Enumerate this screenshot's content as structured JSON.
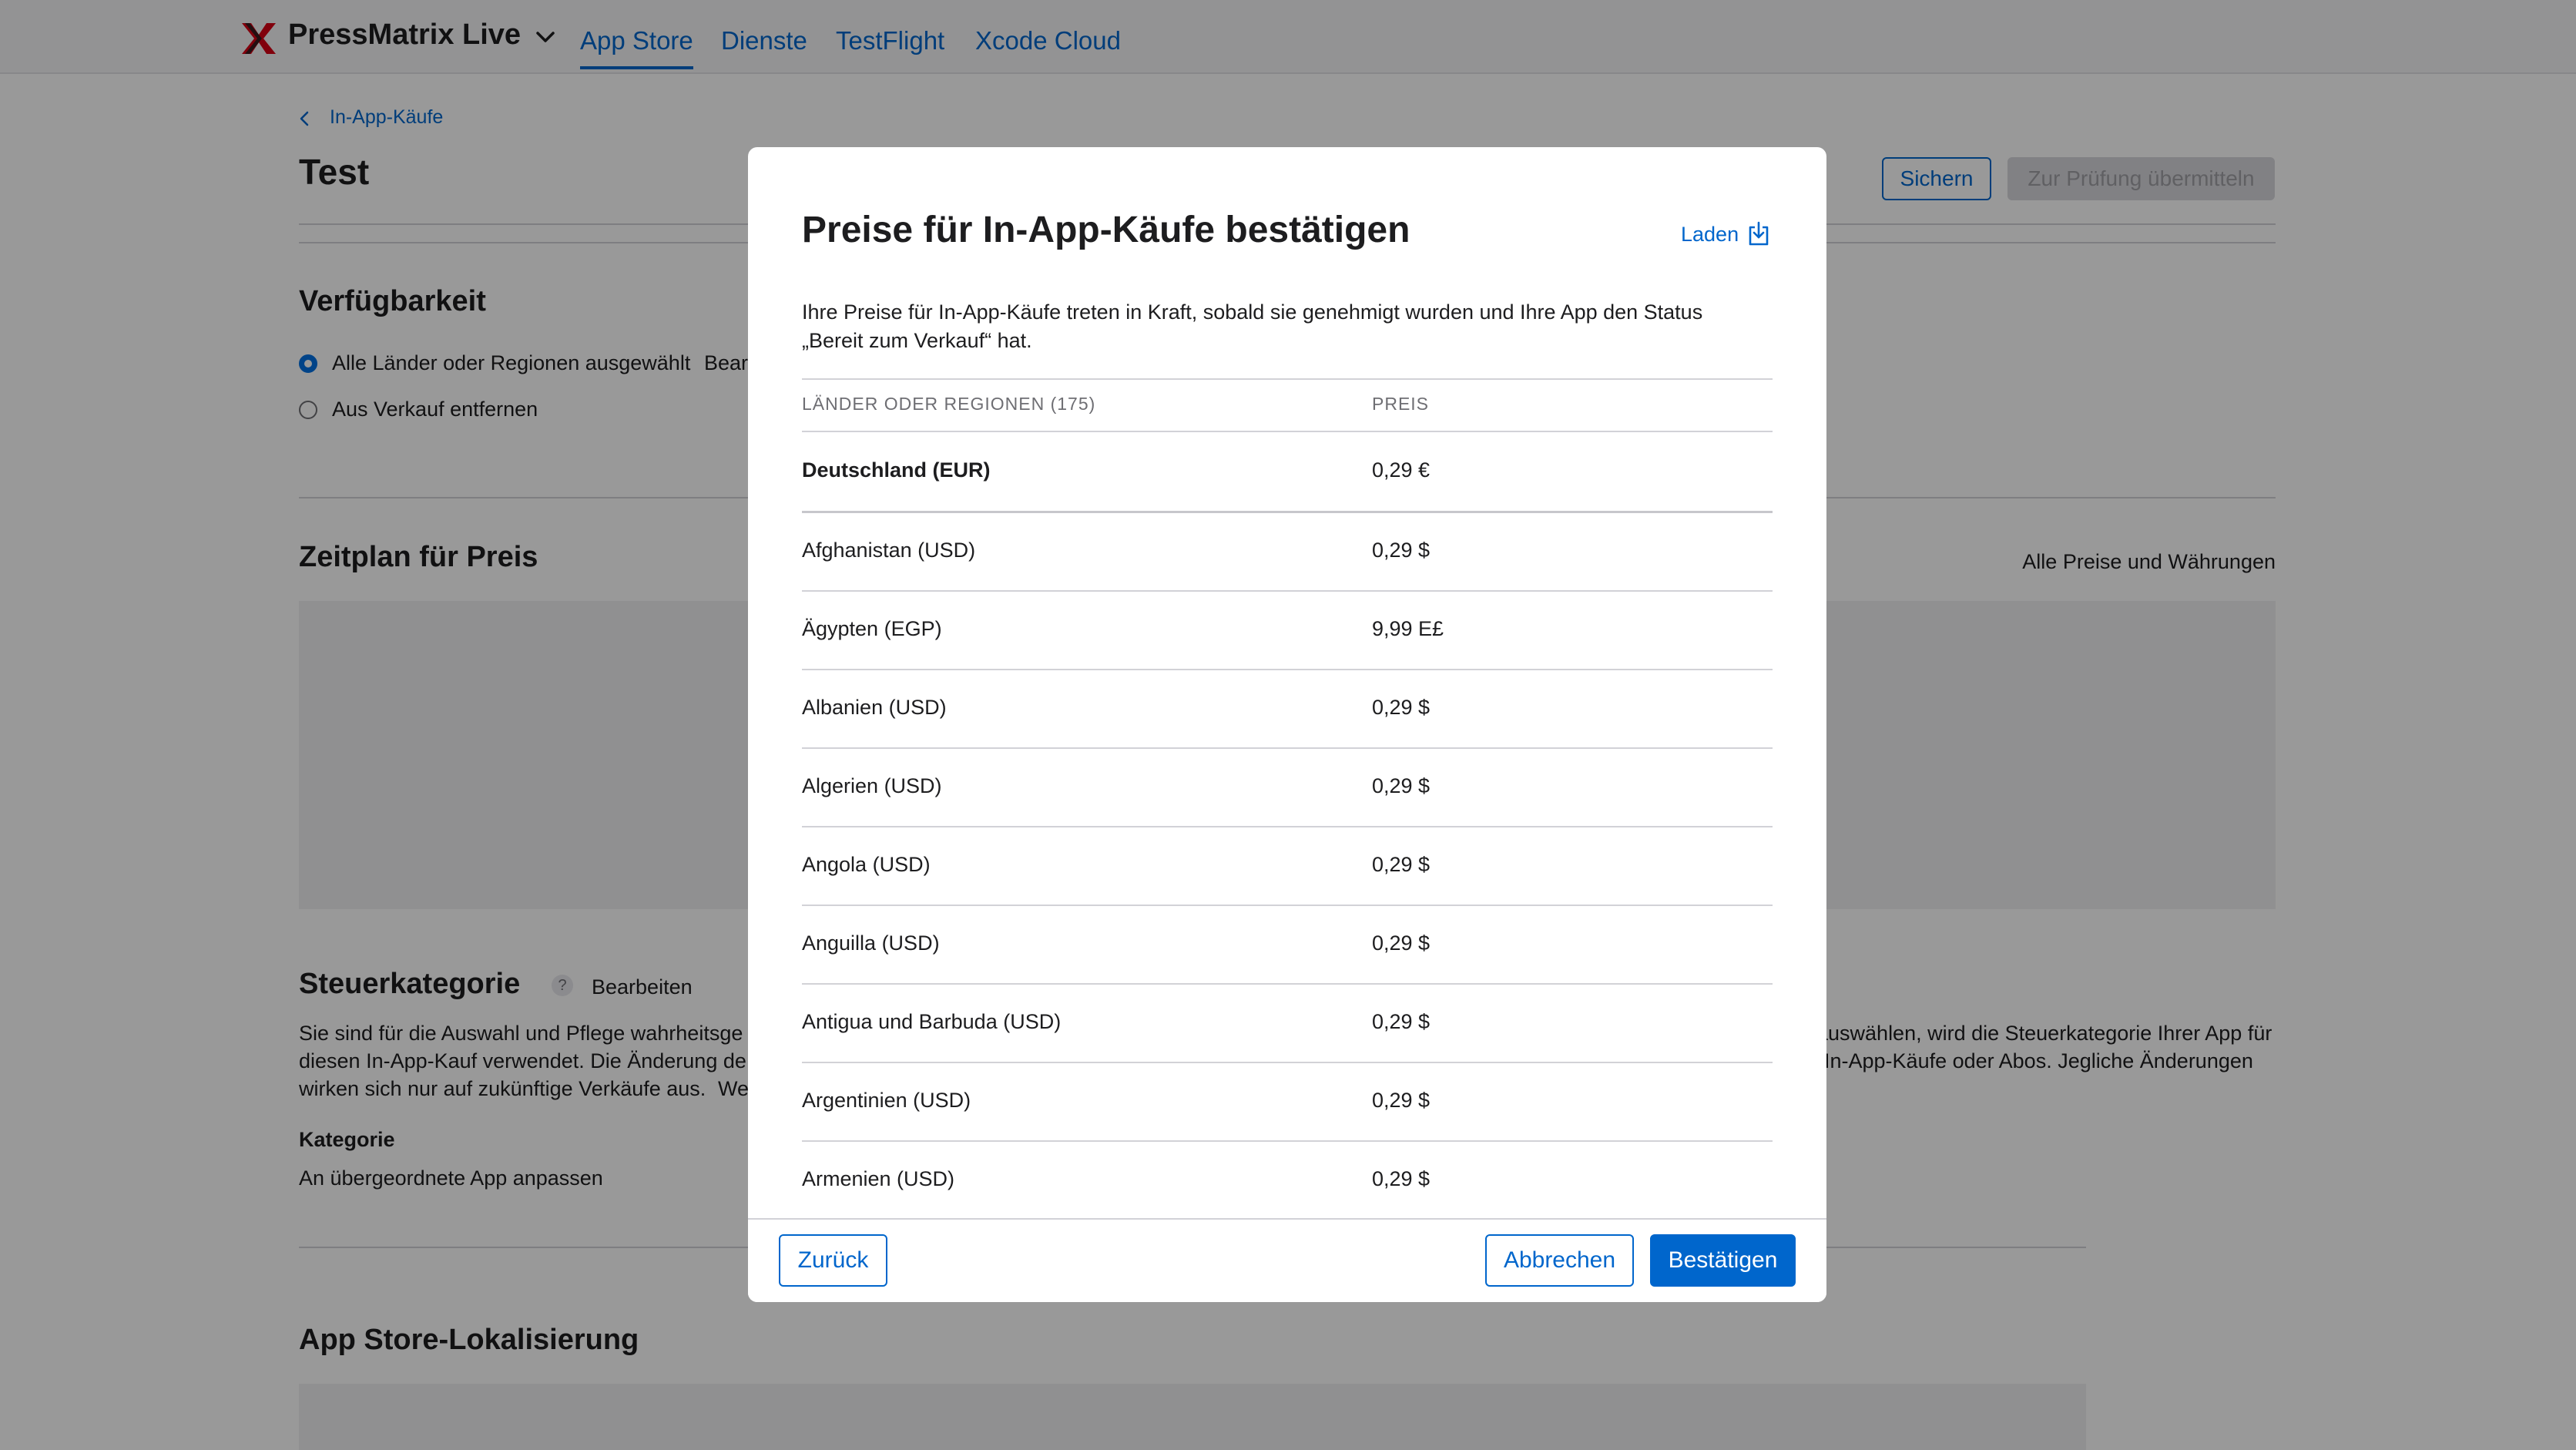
{
  "topbar": {
    "app_name": "PressMatrix Live",
    "tabs": [
      {
        "label": "App Store",
        "active": true
      },
      {
        "label": "Dienste",
        "active": false
      },
      {
        "label": "TestFlight",
        "active": false
      },
      {
        "label": "Xcode Cloud",
        "active": false
      }
    ]
  },
  "page": {
    "breadcrumb": "In-App-Käufe",
    "title": "Test",
    "save_label": "Sichern",
    "submit_label": "Zur Prüfung übermitteln",
    "availability": {
      "title": "Verfügbarkeit",
      "option_all": "Alle Länder oder Regionen ausgewählt",
      "edit_partial": "Bear",
      "option_remove": "Aus Verkauf entfernen"
    },
    "price_schedule": {
      "title": "Zeitplan für Preis",
      "all_prices_link": "Alle Preise und Währungen"
    },
    "tax": {
      "title": "Steuerkategorie",
      "help": "?",
      "edit": "Bearbeiten",
      "line1_left": "Sie sind für die Auswahl und Pflege wahrheitsge",
      "line1_right": "auswählen, wird die Steuerkategorie Ihrer App für",
      "line2_left": "diesen In-App-Kauf verwendet. Die Änderung de",
      "line2_right": "In-App-Käufe oder Abos. Jegliche Änderungen",
      "line3_left": "wirken sich nur auf zukünftige Verkäufe aus.",
      "line3_link": "We",
      "category_label": "Kategorie",
      "category_value": "An übergeordnete App anpassen"
    },
    "localization": {
      "title": "App Store-Lokalisierung"
    }
  },
  "modal": {
    "title": "Preise für In-App-Käufe bestätigen",
    "download_label": "Laden",
    "description": "Ihre Preise für In-App-Käufe treten in Kraft, sobald sie genehmigt wurden und Ihre App den Status „Bereit zum Verkauf“ hat.",
    "col_country": "LÄNDER ODER REGIONEN (175)",
    "col_price": "PREIS",
    "rows": [
      {
        "country": "Deutschland (EUR)",
        "price": "0,29 €",
        "bold": true
      },
      {
        "country": "Afghanistan (USD)",
        "price": "0,29 $"
      },
      {
        "country": "Ägypten (EGP)",
        "price": "9,99 E£"
      },
      {
        "country": "Albanien (USD)",
        "price": "0,29 $"
      },
      {
        "country": "Algerien (USD)",
        "price": "0,29 $"
      },
      {
        "country": "Angola (USD)",
        "price": "0,29 $"
      },
      {
        "country": "Anguilla (USD)",
        "price": "0,29 $"
      },
      {
        "country": "Antigua und Barbuda (USD)",
        "price": "0,29 $"
      },
      {
        "country": "Argentinien (USD)",
        "price": "0,29 $"
      },
      {
        "country": "Armenien (USD)",
        "price": "0,29 $"
      }
    ],
    "back_label": "Zurück",
    "cancel_label": "Abbrechen",
    "confirm_label": "Bestätigen"
  },
  "colors": {
    "accent": "#0066cc",
    "brand_logo": "#d70015",
    "overlay": "rgba(0,0,0,0.40)"
  },
  "icons": [
    "pressmatrix-logo-icon",
    "chevron-down-icon",
    "chevron-left-icon",
    "download-icon",
    "help-icon"
  ]
}
